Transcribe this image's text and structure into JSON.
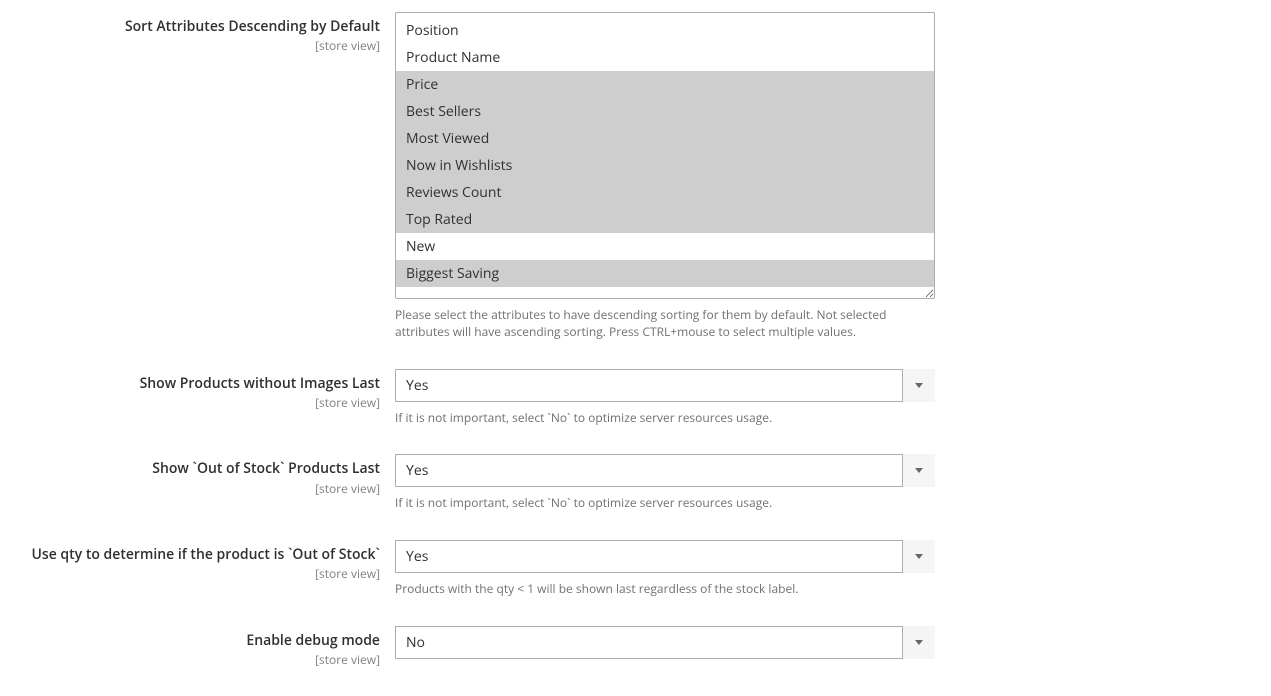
{
  "scope_label": "[store view]",
  "fields": {
    "sort_desc": {
      "label": "Sort Attributes Descending by Default",
      "options": {
        "position": "Position",
        "product_name": "Product Name",
        "price": "Price",
        "best_sellers": "Best Sellers",
        "most_viewed": "Most Viewed",
        "now_in_wishlists": "Now in Wishlists",
        "reviews_count": "Reviews Count",
        "top_rated": "Top Rated",
        "new": "New",
        "biggest_saving": "Biggest Saving"
      },
      "note": "Please select the attributes to have descending sorting for them by default. Not selected attributes will have ascending sorting. Press CTRL+mouse to select multiple values."
    },
    "show_no_image_last": {
      "label": "Show Products without Images Last",
      "value": "Yes",
      "note": "If it is not important, select `No` to optimize server resources usage."
    },
    "show_oos_last": {
      "label": "Show `Out of Stock` Products Last",
      "value": "Yes",
      "note": "If it is not important, select `No` to optimize server resources usage."
    },
    "use_qty_oos": {
      "label": "Use qty to determine if the product is `Out of Stock`",
      "value": "Yes",
      "note": "Products with the qty < 1 will be shown last regardless of the stock label."
    },
    "debug_mode": {
      "label": "Enable debug mode",
      "value": "No"
    }
  }
}
